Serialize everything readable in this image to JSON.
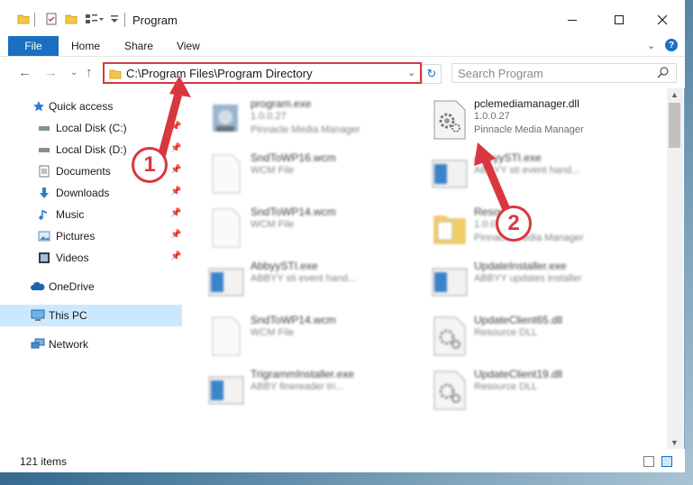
{
  "window": {
    "title": "Program",
    "ribbon_tabs": {
      "file": "File",
      "home": "Home",
      "share": "Share",
      "view": "View"
    },
    "help": "?"
  },
  "address_bar": {
    "path": "C:\\Program Files\\Program Directory",
    "search_placeholder": "Search Program"
  },
  "nav_pane": {
    "items": [
      {
        "label": "Quick access",
        "icon": "star-icon",
        "pinned": false
      },
      {
        "label": "Local Disk (C:)",
        "icon": "disk-icon",
        "pinned": true
      },
      {
        "label": "Local Disk (D:)",
        "icon": "disk-icon",
        "pinned": true
      },
      {
        "label": "Documents",
        "icon": "documents-icon",
        "pinned": true
      },
      {
        "label": "Downloads",
        "icon": "download-icon",
        "pinned": true
      },
      {
        "label": "Music",
        "icon": "music-icon",
        "pinned": true
      },
      {
        "label": "Pictures",
        "icon": "pictures-icon",
        "pinned": true
      },
      {
        "label": "Videos",
        "icon": "videos-icon",
        "pinned": true
      },
      {
        "label": "OneDrive",
        "icon": "cloud-icon",
        "pinned": false
      },
      {
        "label": "This PC",
        "icon": "computer-icon",
        "pinned": false,
        "selected": true
      },
      {
        "label": "Network",
        "icon": "network-icon",
        "pinned": false
      }
    ]
  },
  "files": [
    {
      "name": "program.exe",
      "sub1": "1.0.0.27",
      "sub2": "Pinnacle Media Manager",
      "icon": "exe-icon"
    },
    {
      "name": "pclemediamanager.dll",
      "sub1": "1.0.0.27",
      "sub2": "Pinnacle Media Manager",
      "icon": "dll-gear-icon",
      "highlighted": true
    },
    {
      "name": "SndToWP16.wcm",
      "sub1": "WCM File",
      "sub2": "",
      "icon": "blank-file-icon"
    },
    {
      "name": "AbbyySTI.exe",
      "sub1": "ABBYY sti event hand...",
      "sub2": "",
      "icon": "app-window-icon"
    },
    {
      "name": "SndToWP14.wcm",
      "sub1": "WCM File",
      "sub2": "",
      "icon": "blank-file-icon"
    },
    {
      "name": "Resources",
      "sub1": "1.0.0.27",
      "sub2": "Pinnacle Media Manager",
      "icon": "folder-file-icon"
    },
    {
      "name": "AbbyySTI.exe",
      "sub1": "ABBYY sti event hand...",
      "sub2": "",
      "icon": "app-window-icon"
    },
    {
      "name": "UpdateInstaller.exe",
      "sub1": "ABBYY updates installer",
      "sub2": "",
      "icon": "app-window-icon"
    },
    {
      "name": "SndToWP14.wcm",
      "sub1": "WCM File",
      "sub2": "",
      "icon": "blank-file-icon"
    },
    {
      "name": "UpdateClient65.dll",
      "sub1": "Resource DLL",
      "sub2": "",
      "icon": "dll-gear-icon"
    },
    {
      "name": "TrigrammInstaller.exe",
      "sub1": "ABBY finereader tri...",
      "sub2": "",
      "icon": "app-window-icon"
    },
    {
      "name": "UpdateClient19.dll",
      "sub1": "Resource DLL",
      "sub2": "",
      "icon": "dll-gear-icon"
    }
  ],
  "status": {
    "item_count": "121 items"
  },
  "callouts": [
    "1",
    "2"
  ],
  "colors": {
    "accent": "#1a6fc0",
    "highlight": "#d9373f",
    "selected": "#cce8ff"
  }
}
